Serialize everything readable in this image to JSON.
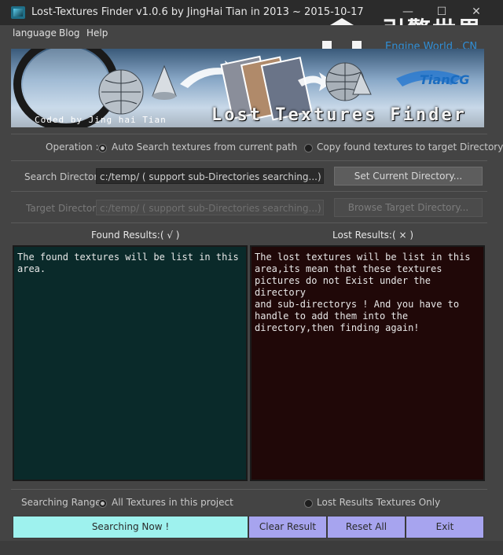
{
  "window": {
    "title": "Lost-Textures Finder v1.0.6 by JingHai Tian in 2013 ~ 2015-10-17",
    "minimize": "—",
    "maximize": "☐",
    "close": "✕"
  },
  "watermark": {
    "cn": "引擎世界",
    "en": "Engine World . CN"
  },
  "menu": [
    "language",
    "Blog",
    "Help"
  ],
  "banner": {
    "coded_by": "Coded by Jing hai Tian",
    "title": "Lost Textures Finder",
    "brand": "TianCG"
  },
  "operation": {
    "label": "Operation :",
    "option1": "Auto Search textures from current path",
    "option2": "Copy found textures to target Directory",
    "selected": 1
  },
  "search_dir": {
    "label": "Search Directory:",
    "value": "c:/temp/ ( support sub-Directories searching...)",
    "button": "Set Current Directory..."
  },
  "target_dir": {
    "label": "Target Directory:",
    "value": "c:/temp/ ( support sub-Directories searching...)",
    "button": "Browse Target Directory..."
  },
  "found": {
    "header": "Found Results:( √ )",
    "text": "The found textures will be list in this\narea."
  },
  "lost": {
    "header": "Lost Results:( × )",
    "text": "The lost textures will be list in this\narea,its mean that these textures\npictures do not Exist under the directory\nand sub-directorys ! And you have to\nhandle to add them into the\ndirectory,then finding again!"
  },
  "range": {
    "label": "Searching Range:",
    "option1": "All Textures in this project",
    "option2": "Lost Results Textures Only",
    "selected": 1
  },
  "buttons": {
    "search": "Searching  Now !",
    "clear": "Clear Result",
    "reset": "Reset All",
    "exit": "Exit"
  },
  "colors": {
    "search_btn": "#9ef2ee",
    "action_btn": "#a7a4ef",
    "found_bg": "#0a2a2a",
    "lost_bg": "#200808"
  }
}
